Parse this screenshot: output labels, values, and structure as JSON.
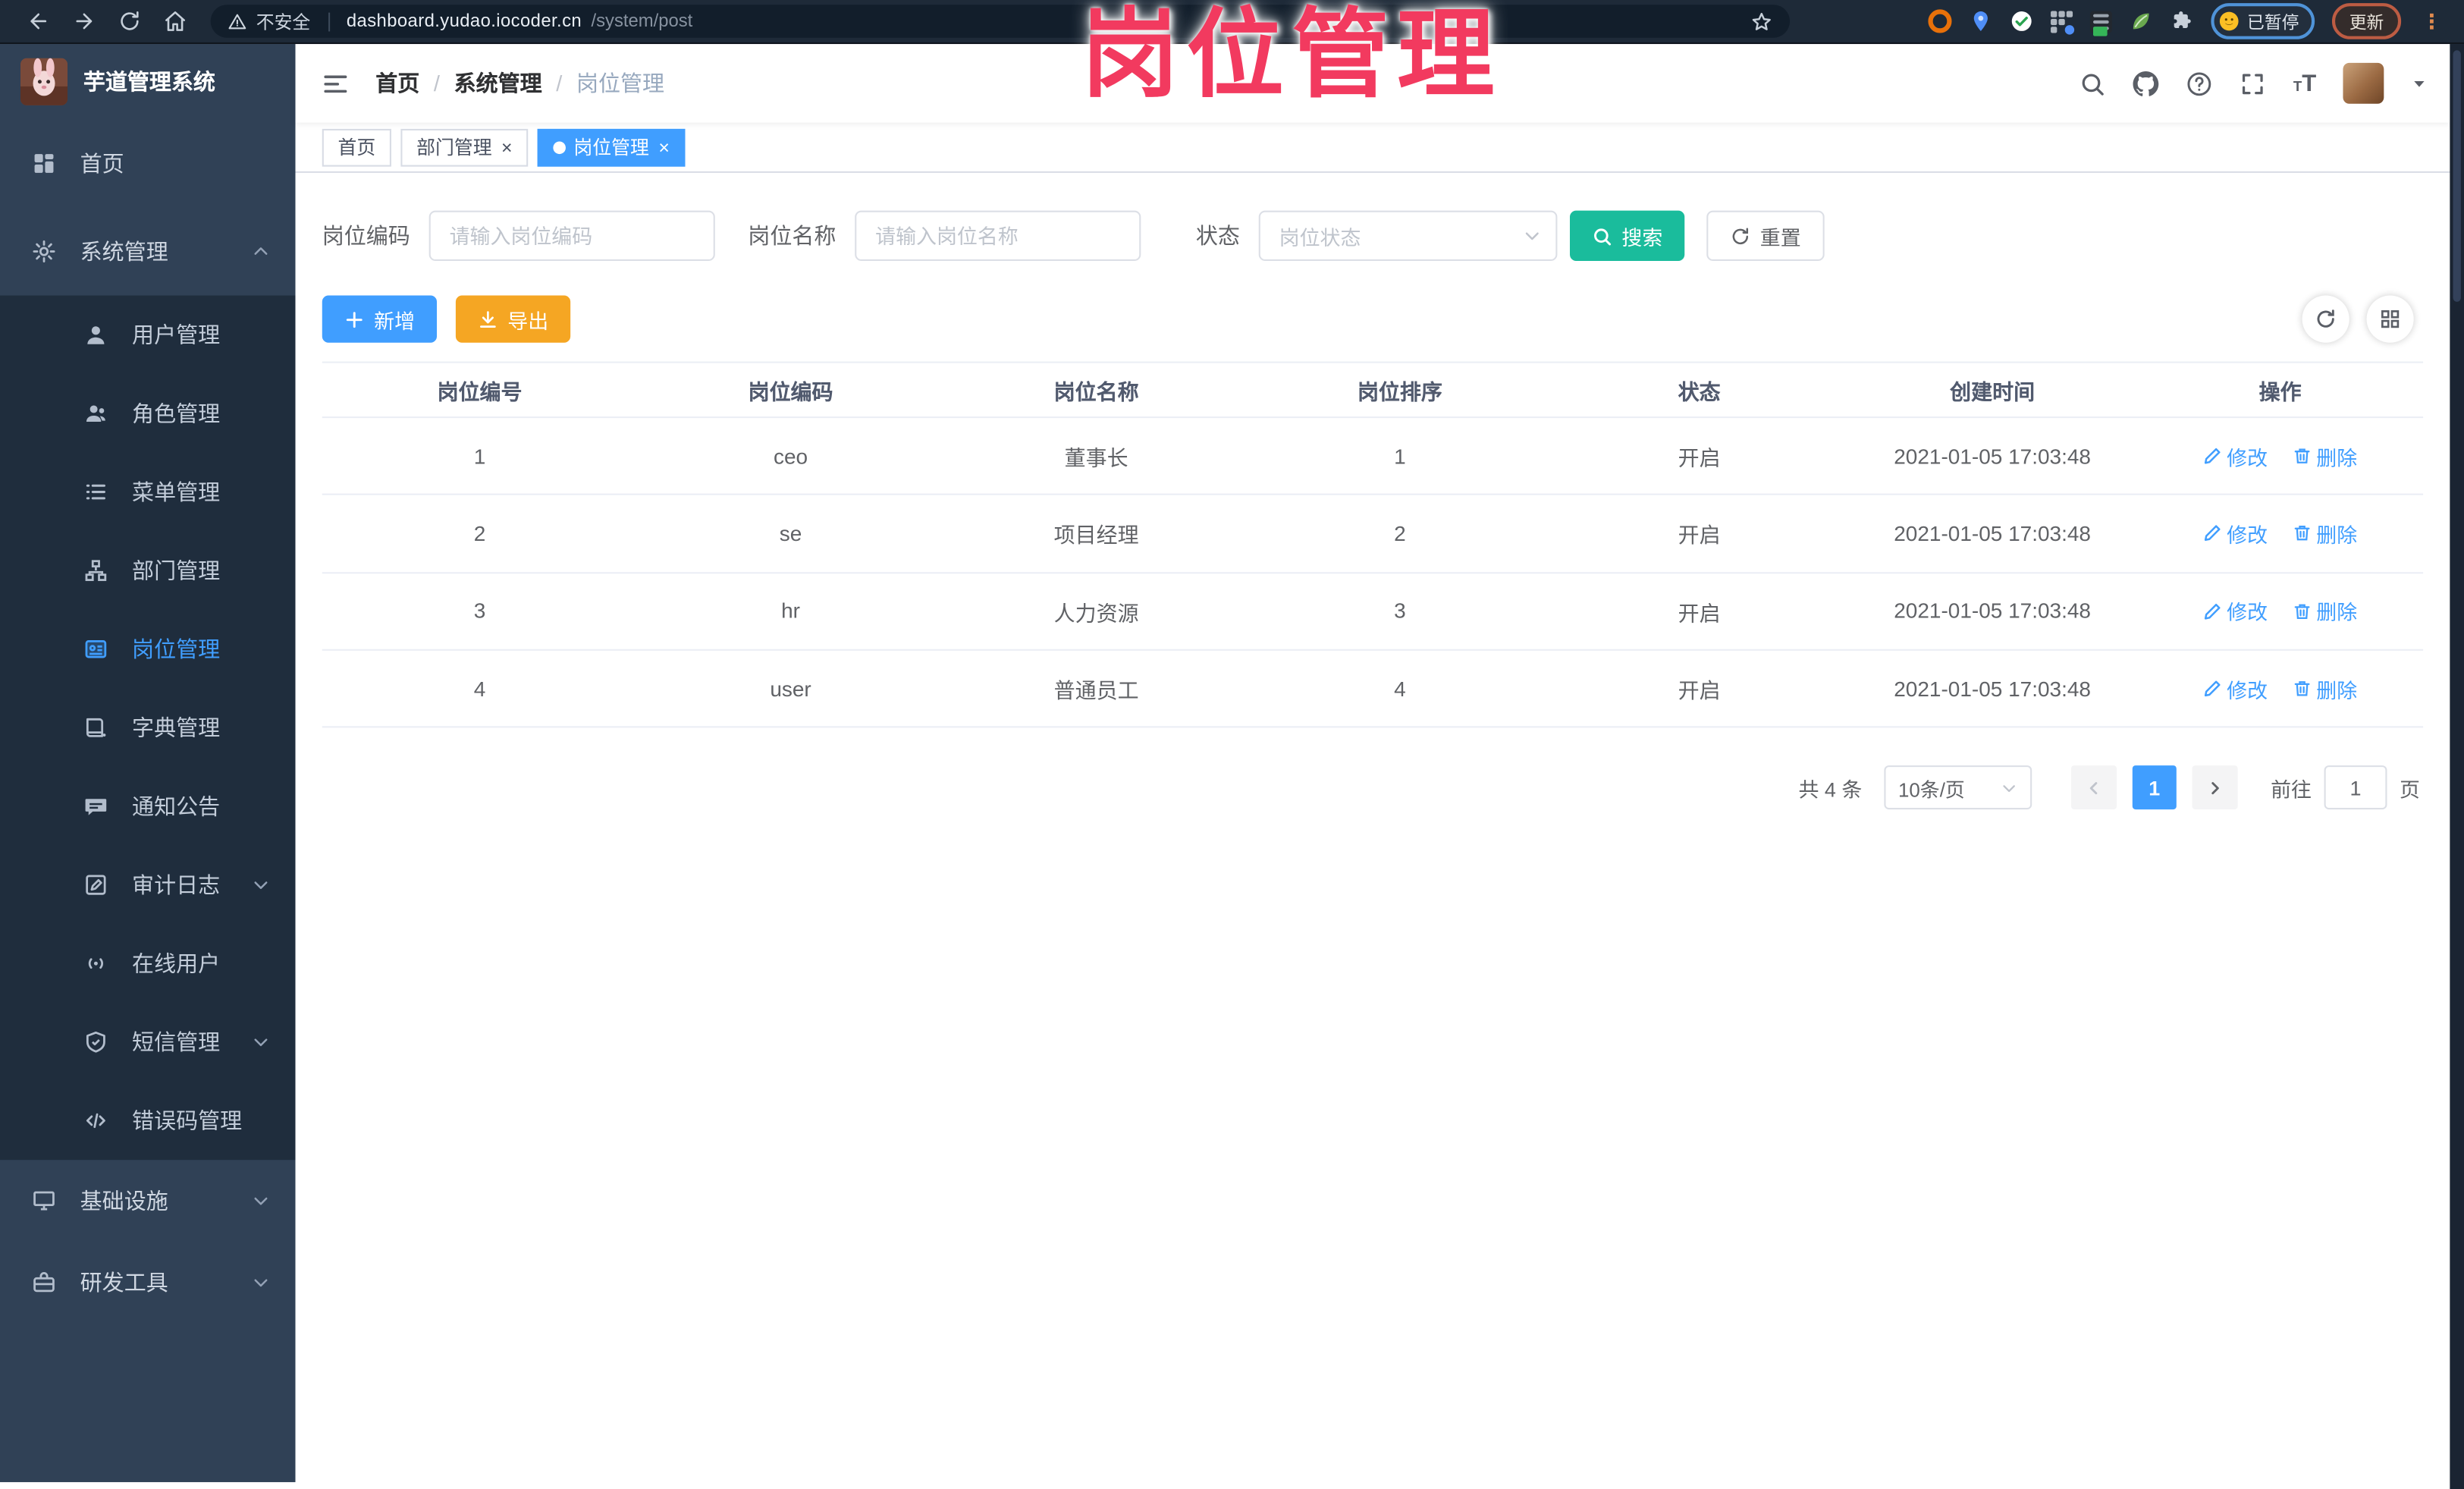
{
  "browser": {
    "security_label": "不安全",
    "url_host": "dashboard.yudao.iocoder.cn",
    "url_path": "/system/post",
    "profile_status": "已暂停",
    "update_label": "更新"
  },
  "annotation": {
    "text": "岗位管理",
    "color": "#f23a5f"
  },
  "sidebar": {
    "title": "芋道管理系统",
    "home": "首页",
    "system": "系统管理",
    "submenu": [
      "用户管理",
      "角色管理",
      "菜单管理",
      "部门管理",
      "岗位管理",
      "字典管理",
      "通知公告",
      "审计日志",
      "在线用户",
      "短信管理",
      "错误码管理"
    ],
    "bottom": [
      "基础设施",
      "研发工具"
    ]
  },
  "breadcrumb": [
    "首页",
    "系统管理",
    "岗位管理"
  ],
  "tabs": [
    "首页",
    "部门管理",
    "岗位管理"
  ],
  "filters": {
    "code_label": "岗位编码",
    "code_placeholder": "请输入岗位编码",
    "name_label": "岗位名称",
    "name_placeholder": "请输入岗位名称",
    "status_label": "状态",
    "status_placeholder": "岗位状态",
    "search_label": "搜索",
    "reset_label": "重置"
  },
  "toolbar": {
    "add_label": "新增",
    "export_label": "导出"
  },
  "table": {
    "headers": [
      "岗位编号",
      "岗位编码",
      "岗位名称",
      "岗位排序",
      "状态",
      "创建时间",
      "操作"
    ],
    "rows": [
      [
        "1",
        "ceo",
        "董事长",
        "1",
        "开启",
        "2021-01-05 17:03:48"
      ],
      [
        "2",
        "se",
        "项目经理",
        "2",
        "开启",
        "2021-01-05 17:03:48"
      ],
      [
        "3",
        "hr",
        "人力资源",
        "3",
        "开启",
        "2021-01-05 17:03:48"
      ],
      [
        "4",
        "user",
        "普通员工",
        "4",
        "开启",
        "2021-01-05 17:03:48"
      ]
    ],
    "edit_label": "修改",
    "delete_label": "删除"
  },
  "pagination": {
    "total": "共 4 条",
    "page_size": "10条/页",
    "current_page": "1",
    "goto_label": "前往",
    "goto_value": "1",
    "page_unit": "页"
  },
  "colors": {
    "accent": "#409eff",
    "search_button": "#1abc9c",
    "export_button": "#f5a623",
    "annotation": "#f23a5f",
    "sidebar_bg": "#304156",
    "submenu_bg": "#1f2d3d"
  }
}
